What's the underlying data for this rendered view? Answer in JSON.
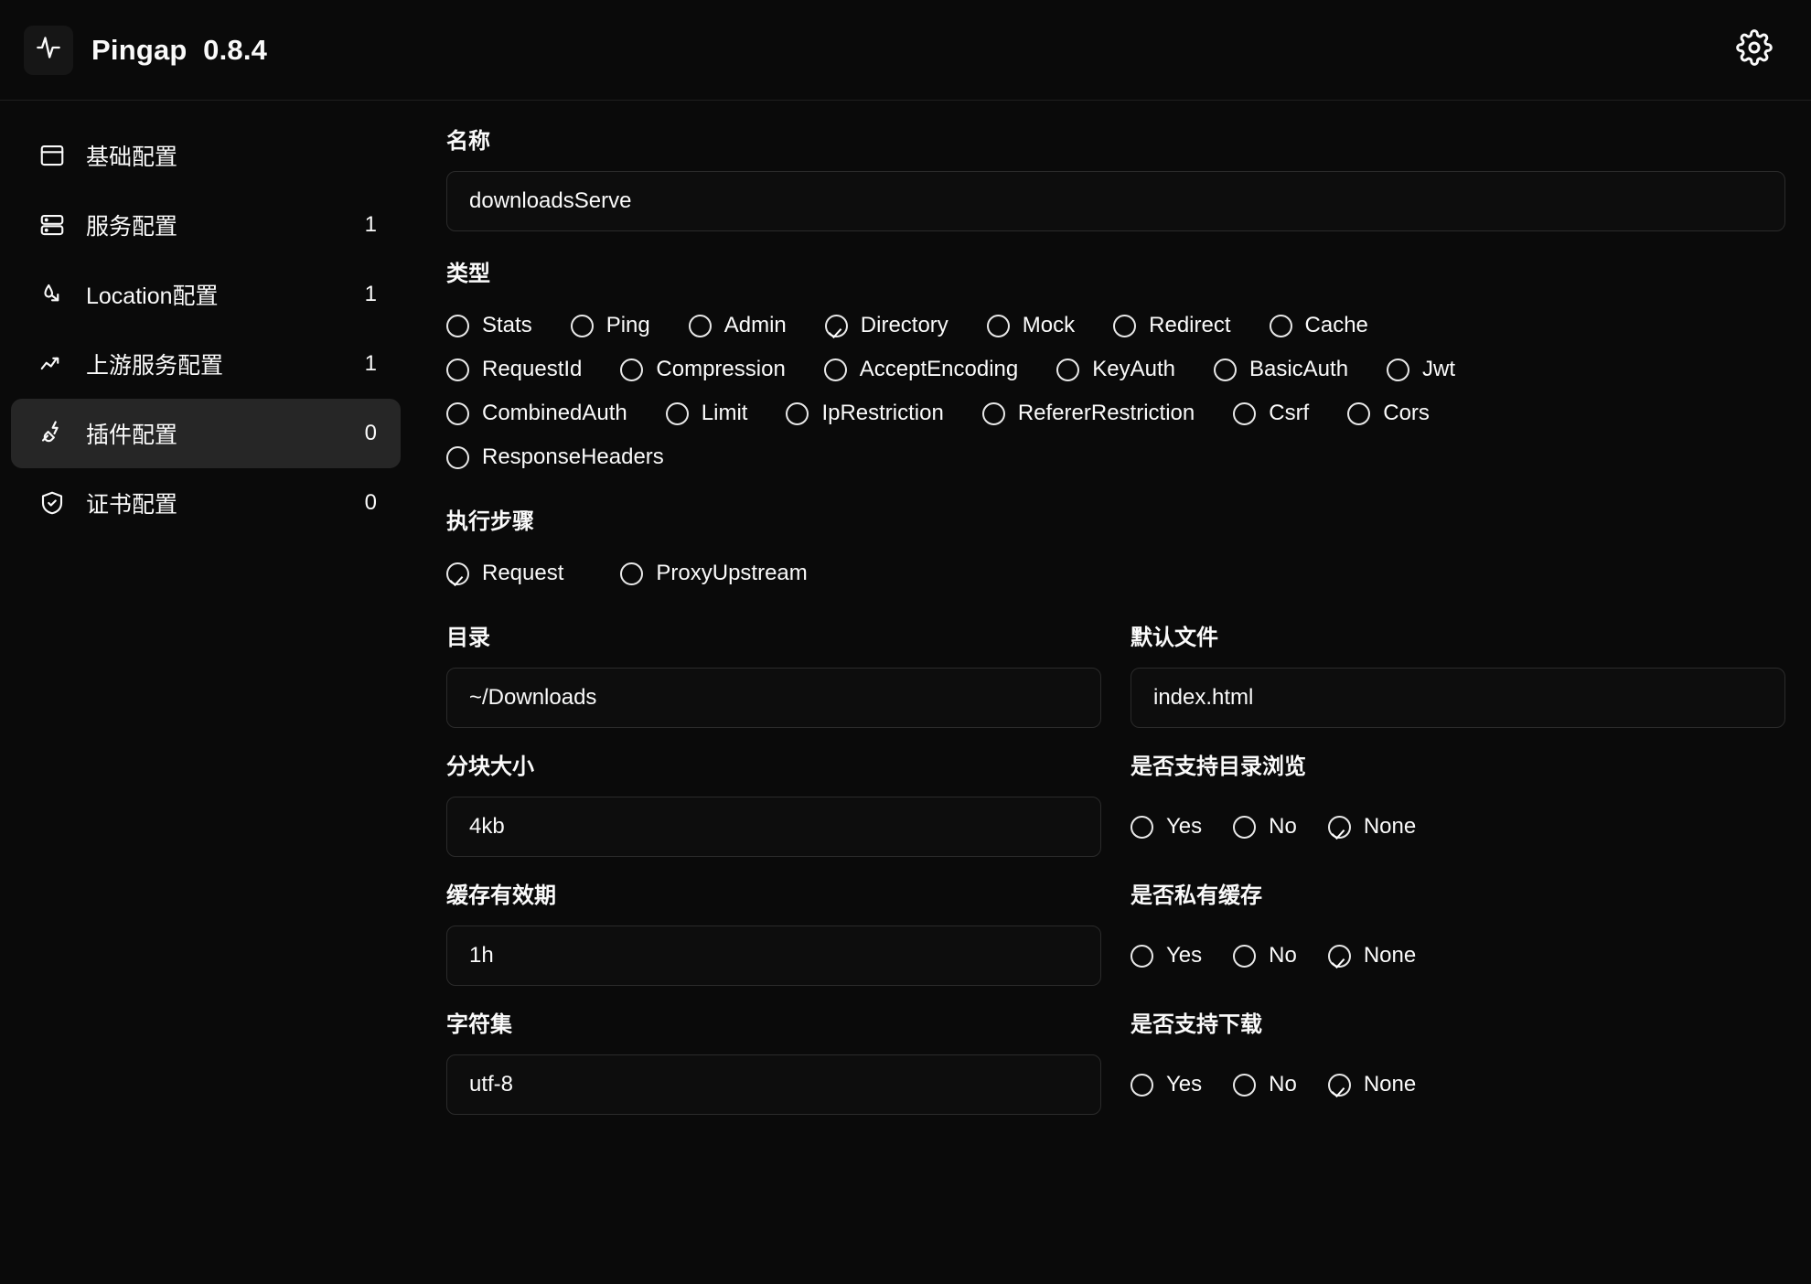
{
  "header": {
    "logo_icon": "activity-pulse-icon",
    "title": "Pingap  0.8.4",
    "settings_icon": "gear-icon"
  },
  "sidebar": {
    "items": [
      {
        "label": "基础配置",
        "count": "",
        "icon": "window-icon"
      },
      {
        "label": "服务配置",
        "count": "1",
        "icon": "server-icon"
      },
      {
        "label": "Location配置",
        "count": "1",
        "icon": "route-icon"
      },
      {
        "label": "上游服务配置",
        "count": "1",
        "icon": "trending-up-icon"
      },
      {
        "label": "插件配置",
        "count": "0",
        "icon": "plug-zap-icon",
        "active": true
      },
      {
        "label": "证书配置",
        "count": "0",
        "icon": "shield-check-icon"
      }
    ]
  },
  "main": {
    "name": {
      "label": "名称",
      "value": "downloadsServe",
      "placeholder": "名称"
    },
    "type": {
      "label": "类型",
      "selected": "Directory",
      "options": [
        "Stats",
        "Ping",
        "Admin",
        "Directory",
        "Mock",
        "Redirect",
        "Cache",
        "RequestId",
        "Compression",
        "AcceptEncoding",
        "KeyAuth",
        "BasicAuth",
        "Jwt",
        "CombinedAuth",
        "Limit",
        "IpRestriction",
        "RefererRestriction",
        "Csrf",
        "Cors",
        "ResponseHeaders"
      ],
      "row_breaks": [
        7,
        13,
        19
      ]
    },
    "step": {
      "label": "执行步骤",
      "selected": "Request",
      "options": [
        "Request",
        "ProxyUpstream"
      ]
    },
    "fields": [
      {
        "left": {
          "kind": "input",
          "label": "目录",
          "value": "~/Downloads",
          "placeholder": "目录"
        },
        "right": {
          "kind": "input",
          "label": "默认文件",
          "value": "index.html",
          "placeholder": "默认文件"
        }
      },
      {
        "left": {
          "kind": "input",
          "label": "分块大小",
          "value": "4kb",
          "placeholder": "分块大小"
        },
        "right": {
          "kind": "tri",
          "label": "是否支持目录浏览",
          "selected": "None",
          "options": [
            "Yes",
            "No",
            "None"
          ]
        }
      },
      {
        "left": {
          "kind": "input",
          "label": "缓存有效期",
          "value": "1h",
          "placeholder": "缓存有效期"
        },
        "right": {
          "kind": "tri",
          "label": "是否私有缓存",
          "selected": "None",
          "options": [
            "Yes",
            "No",
            "None"
          ]
        }
      },
      {
        "left": {
          "kind": "input",
          "label": "字符集",
          "value": "utf-8",
          "placeholder": "字符集"
        },
        "right": {
          "kind": "tri",
          "label": "是否支持下载",
          "selected": "None",
          "options": [
            "Yes",
            "No",
            "None"
          ]
        }
      }
    ]
  },
  "colors": {
    "background": "#0a0a0a",
    "panel": "#0d0d0d",
    "border": "#2b2b2b",
    "active": "#262626",
    "text": "#fafafa"
  }
}
